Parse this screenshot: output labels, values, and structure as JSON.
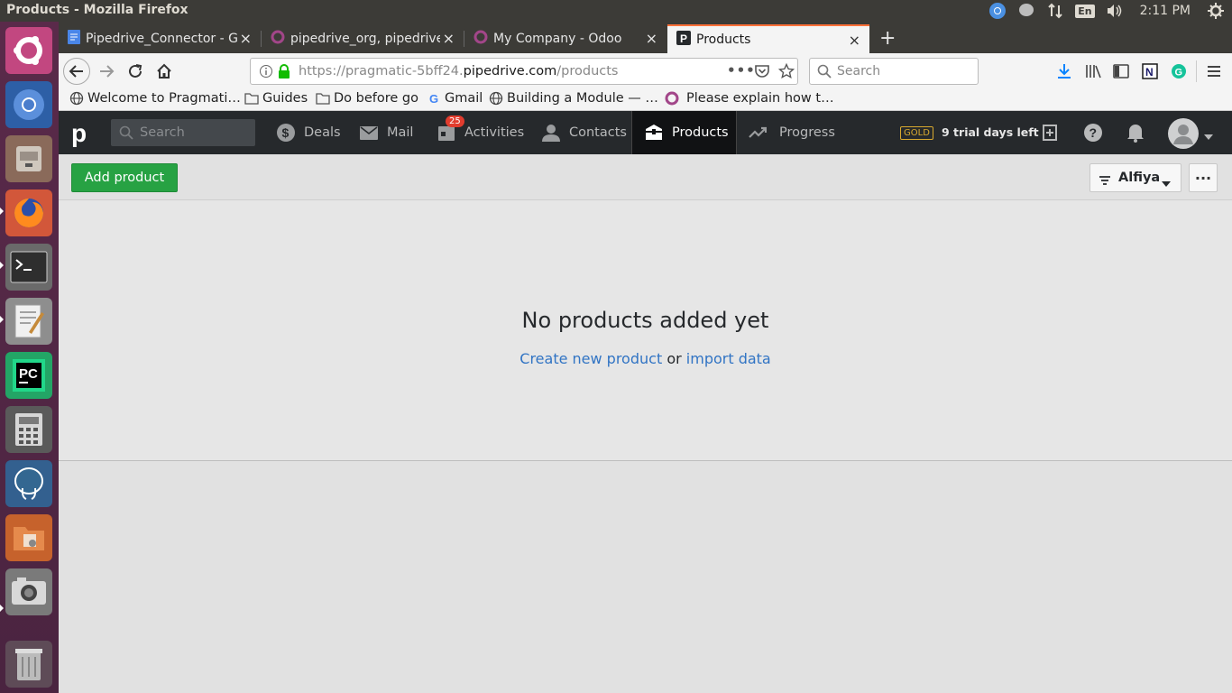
{
  "os": {
    "window_title": "Products - Mozilla Firefox",
    "lang": "En",
    "clock": "2:11 PM"
  },
  "tabs": [
    {
      "label": "Pipedrive_Connector - G",
      "icon": "doc-icon"
    },
    {
      "label": "pipedrive_org, pipedrive",
      "icon": "odoo-icon"
    },
    {
      "label": "My Company - Odoo",
      "icon": "odoo-icon"
    },
    {
      "label": "Products",
      "icon": "pipedrive-icon",
      "active": true
    }
  ],
  "navbar": {
    "url_prefix": "https://pragmatic-5bff24.",
    "url_host": "pipedrive.com",
    "url_path": "/products",
    "search_placeholder": "Search"
  },
  "bookmarks": [
    {
      "label": "Welcome to Pragmati…",
      "icon": "globe-icon"
    },
    {
      "label": "Guides",
      "icon": "folder-icon"
    },
    {
      "label": "Do before go",
      "icon": "folder-icon"
    },
    {
      "label": "Gmail",
      "icon": "google-icon"
    },
    {
      "label": "Building a Module — …",
      "icon": "globe-icon"
    },
    {
      "label": "Please explain how t…",
      "icon": "odoo-icon"
    }
  ],
  "pipedrive": {
    "logo": "p",
    "search_placeholder": "Search",
    "nav": [
      {
        "label": "Deals"
      },
      {
        "label": "Mail"
      },
      {
        "label": "Activities",
        "badge": "25"
      },
      {
        "label": "Contacts"
      },
      {
        "label": "Products",
        "active": true
      },
      {
        "label": "Progress"
      }
    ],
    "plan_badge": "GOLD",
    "trial_text": "9 trial days left"
  },
  "content": {
    "add_button": "Add product",
    "filter_user": "Alfiya",
    "more_button": "···",
    "empty_title": "No products added yet",
    "create_link": "Create new product",
    "or_text": "or",
    "import_link": "import data"
  },
  "colors": {
    "accent_green": "#27a243",
    "link_blue": "#3174c4",
    "header_dark": "#26292c",
    "badge_red": "#e23c2e"
  }
}
